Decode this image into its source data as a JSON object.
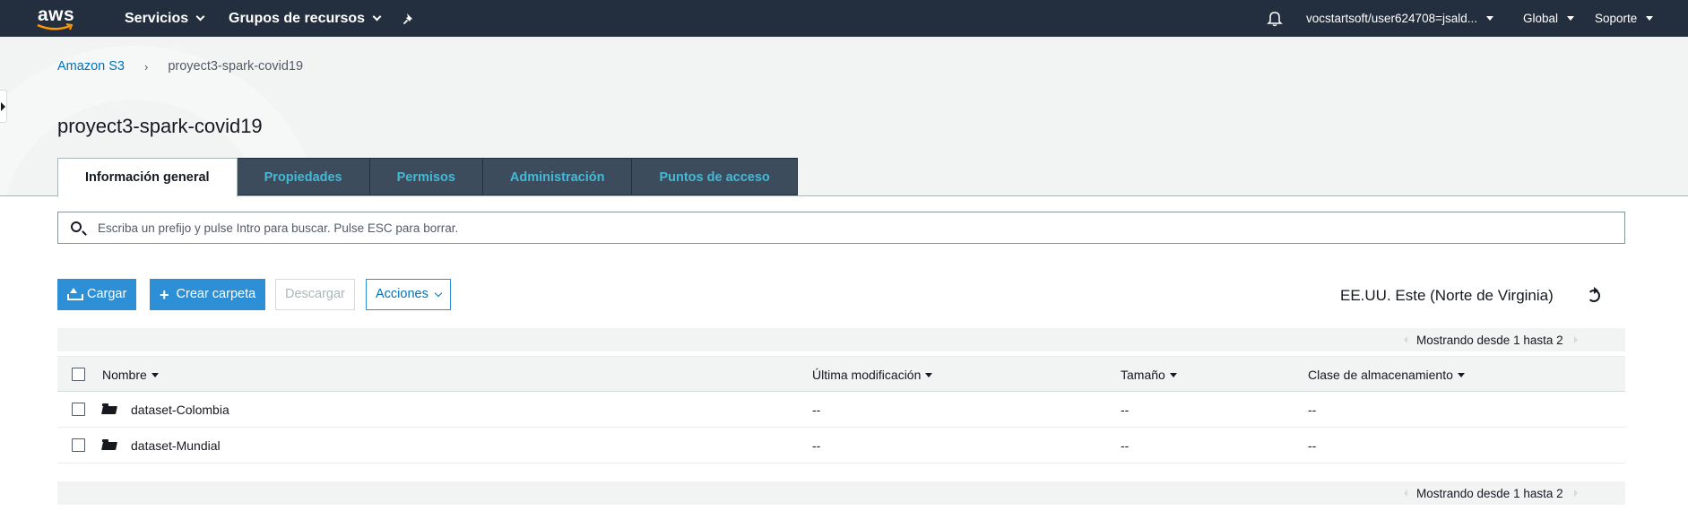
{
  "topnav": {
    "logo_text": "aws",
    "services": "Servicios",
    "resource_groups": "Grupos de recursos",
    "account": "vocstartsoft/user624708=jsald...",
    "region": "Global",
    "support": "Soporte"
  },
  "breadcrumb": {
    "root": "Amazon S3",
    "separator": "›",
    "current": "proyect3-spark-covid19"
  },
  "page_title": "proyect3-spark-covid19",
  "tabs": [
    {
      "label": "Información general",
      "active": true
    },
    {
      "label": "Propiedades",
      "active": false
    },
    {
      "label": "Permisos",
      "active": false
    },
    {
      "label": "Administración",
      "active": false
    },
    {
      "label": "Puntos de acceso",
      "active": false
    }
  ],
  "search": {
    "placeholder": "Escriba un prefijo y pulse Intro para buscar. Pulse ESC para borrar.",
    "value": ""
  },
  "actions": {
    "upload": "Cargar",
    "create_folder": "Crear carpeta",
    "download": "Descargar",
    "actions_menu": "Acciones"
  },
  "region_label": "EE.UU. Este (Norte de Virginia)",
  "pagination": "Mostrando desde 1 hasta 2",
  "table": {
    "columns": [
      "Nombre",
      "Última modificación",
      "Tamaño",
      "Clase de almacenamiento"
    ],
    "rows": [
      {
        "name": "dataset-Colombia",
        "modified": "--",
        "size": "--",
        "storage_class": "--"
      },
      {
        "name": "dataset-Mundial",
        "modified": "--",
        "size": "--",
        "storage_class": "--"
      }
    ]
  },
  "colors": {
    "nav_bg": "#232f3e",
    "primary": "#2d8fd5",
    "link": "#0073bb",
    "tab_text": "#44b9d6"
  }
}
